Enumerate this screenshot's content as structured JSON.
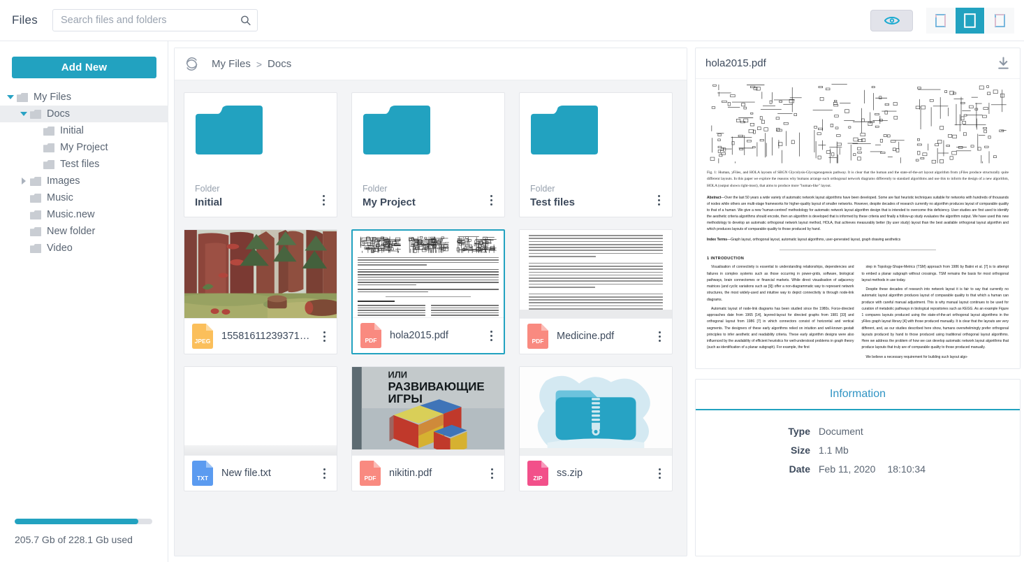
{
  "app": {
    "title": "Files"
  },
  "search": {
    "placeholder": "Search files and folders",
    "value": "",
    "icon": "search-icon"
  },
  "toolbar": {
    "preview_toggle": {
      "icon": "eye-icon",
      "active": true
    },
    "view_modes": [
      {
        "icon": "view-list-icon",
        "active": false
      },
      {
        "icon": "view-grid-icon",
        "active": true
      },
      {
        "icon": "view-details-icon",
        "active": false
      }
    ]
  },
  "sidebar": {
    "add_new_label": "Add New",
    "tree": [
      {
        "label": "My Files",
        "depth": 0,
        "expander": "down",
        "selected": false
      },
      {
        "label": "Docs",
        "depth": 1,
        "expander": "down",
        "selected": true
      },
      {
        "label": "Initial",
        "depth": 2,
        "expander": "none",
        "selected": false
      },
      {
        "label": "My Project",
        "depth": 2,
        "expander": "none",
        "selected": false
      },
      {
        "label": "Test files",
        "depth": 2,
        "expander": "none",
        "selected": false
      },
      {
        "label": "Images",
        "depth": 1,
        "expander": "right",
        "selected": false
      },
      {
        "label": "Music",
        "depth": 1,
        "expander": "none",
        "selected": false
      },
      {
        "label": "Music.new",
        "depth": 1,
        "expander": "none",
        "selected": false
      },
      {
        "label": "New folder",
        "depth": 1,
        "expander": "none",
        "selected": false
      },
      {
        "label": "Video",
        "depth": 1,
        "expander": "none",
        "selected": false
      }
    ],
    "storage": {
      "text": "205.7 Gb of 228.1 Gb used",
      "used_percent": 90
    }
  },
  "breadcrumb": {
    "refresh_icon": "refresh-icon",
    "items": [
      "My Files",
      "Docs"
    ],
    "separator": ">"
  },
  "files": [
    {
      "kind_label": "Folder",
      "name": "Initial",
      "type": "folder",
      "menu_icon": "kebab-menu-icon",
      "selected": false
    },
    {
      "kind_label": "Folder",
      "name": "My Project",
      "type": "folder",
      "menu_icon": "kebab-menu-icon",
      "selected": false
    },
    {
      "kind_label": "Folder",
      "name": "Test files",
      "type": "folder",
      "menu_icon": "kebab-menu-icon",
      "selected": false
    },
    {
      "kind_label": "JPEG",
      "name": "15581611239371…",
      "type": "file",
      "badge": "JPEG",
      "badge_color": "#fbbf5b",
      "thumb": "forest-photo",
      "menu_icon": "kebab-menu-icon",
      "selected": false
    },
    {
      "kind_label": "PDF",
      "name": "hola2015.pdf",
      "type": "file",
      "badge": "PDF",
      "badge_color": "#f98a80",
      "thumb": "paper-hola",
      "menu_icon": "kebab-menu-icon",
      "selected": true
    },
    {
      "kind_label": "PDF",
      "name": "Medicine.pdf",
      "type": "file",
      "badge": "PDF",
      "badge_color": "#f98a80",
      "thumb": "paper-russian",
      "menu_icon": "kebab-menu-icon",
      "selected": false
    },
    {
      "kind_label": "TXT",
      "name": "New file.txt",
      "type": "file",
      "badge": "TXT",
      "badge_color": "#5b9bf0",
      "thumb": "blank",
      "menu_icon": "kebab-menu-icon",
      "selected": false
    },
    {
      "kind_label": "PDF",
      "name": "nikitin.pdf",
      "type": "file",
      "badge": "PDF",
      "badge_color": "#f98a80",
      "thumb": "book-cover",
      "menu_icon": "kebab-menu-icon",
      "selected": false
    },
    {
      "kind_label": "ZIP",
      "name": "ss.zip",
      "type": "file",
      "badge": "ZIP",
      "badge_color": "#f2508a",
      "thumb": "zip-folder",
      "menu_icon": "kebab-menu-icon",
      "selected": false
    }
  ],
  "preview": {
    "title": "hola2015.pdf",
    "download_icon": "download-icon",
    "document": {
      "figure_caption": "Fig. 1: Human, yFiles, and HOLA layouts of SBGN Glycolysis-Glycogenogensis pathway. It is clear that the human and the state-of-the-art layout algorithm from yFiles produce structurally quite different layouts. In this paper we explore the reasons why humans arrange such orthogonal network diagrams differently to standard algorithms and use this to inform the design of a new algorithm, HOLA (output shown right-most), that aims to produce more \"human-like\" layout.",
      "abstract_label": "Abstract",
      "abstract": "Over the last 50 years a wide variety of automatic network layout algorithms have been developed. Some are fast heuristic techniques suitable for networks with hundreds of thousands of nodes while others are multi-stage frameworks for higher-quality layout of smaller networks. However, despite decades of research currently no algorithm produces layout of comparable quality to that of a human. We give a new 'human-centred' methodology for automatic network layout algorithm design that is intended to overcome this deficiency. User studies are first used to identify the aesthetic criteria algorithms should encode, then an algorithm is developed that is informed by these criteria and finally a follow-up study evaluates the algorithm output. We have used this new methodology to develop an automatic orthogonal network layout method, HOLA, that achieves measurably better (by user study) layout than the best available orthogonal layout algorithm and which produces layouts of comparable quality to those produced by hand.",
      "index_terms_label": "Index Terms",
      "index_terms": "Graph layout, orthogonal layout, automatic layout algorithms, user-generated layout, graph drawing aesthetics",
      "section_number": "1",
      "section_title": "INTRODUCTION",
      "col1": "Visualisation of connectivity is essential to understanding relationships, dependencies and failures in complex systems such as those occurring in power-grids, software, biological pathways, brain connectomes or financial markets. While direct visualisation of adjacency matrices (and cyclic variations such as [9]) offer a non-diagrammatic way to represent network structures, the most widely-used and intuitive way to depict connectivity is through node-link diagrams.\n\nAutomatic layout of node-link diagrams has been studied since the 1980s. Force-directed approaches date from 1965 [14], layered-layout for directed graphs from 1981 [33] and orthogonal layout from 1986 [7] in which connectors consist of horizontal and vertical segments. The designers of these early algorithms relied on intuition and well-known gestalt principles to infer aesthetic and readability criteria. These early algorithm designs were also influenced by the availability of efficient heuristics for well-understood problems in graph theory (such as identification of a planar subgraph). For example, the first",
      "col2": "step in Topology-Shape-Metrics (TSM) approach from 1986 by Batini et al. [7] is to attempt to embed a planar subgraph without crossings. TSM remains the basis for most orthogonal layout methods in use today.\n\nDespite these decades of research into network layout it is fair to say that currently no automatic layout algorithm produces layout of comparable quality to that which a human can produce with careful manual adjustment. This is why manual layout continues to be used for curation of metabolic pathways in biological repositories such as KEGG. As an example Figure 1 compares layouts produced using the state-of-the-art orthogonal layout algorithms in the yFiles graph layout library [4] with those produced manually. It is clear that the layouts are very different, and, as our studies described here show, humans overwhelmingly prefer orthogonal layouts produced by hand to those produced using traditional orthogonal layout algorithms. Here we address the problem of how we can develop automatic network layout algorithms that produce layouts that truly are of comparable quality to those produced manually.\n\nWe believe a necessary requirement for building such layout algo-"
    }
  },
  "information": {
    "title": "Information",
    "rows": [
      {
        "label": "Type",
        "value": "Document"
      },
      {
        "label": "Size",
        "value": "1.1 Mb"
      },
      {
        "label": "Date",
        "value": "Feb 11, 2020",
        "value2": "18:10:34"
      }
    ]
  },
  "colors": {
    "accent": "#22a2c0",
    "accent_dark": "#1e93b0",
    "info_title": "#3094c4",
    "text": "#3d4a5c",
    "muted": "#96a0ad",
    "panel_bg": "#f3f4f6"
  }
}
